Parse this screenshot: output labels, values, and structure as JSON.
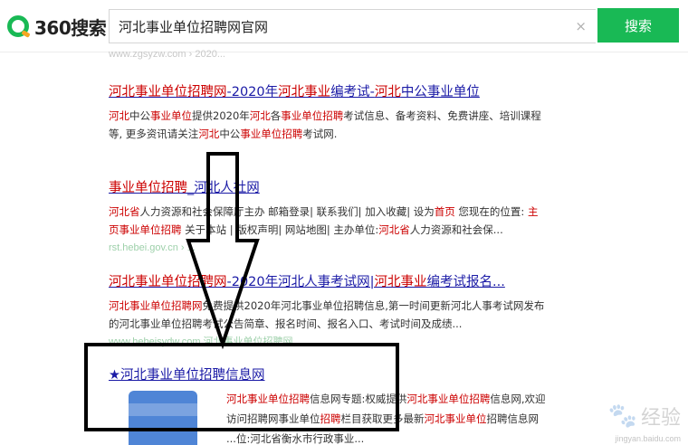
{
  "header": {
    "logo_text": "360搜索",
    "search_value": "河北事业单位招聘网官网",
    "clear_icon": "×",
    "search_button": "搜索"
  },
  "faded_top_url": "www.zgsyzw.com › 2020...",
  "results": [
    {
      "title_a": "河北事业单位招聘网",
      "title_b": "-2020年",
      "title_c": "河北事业",
      "title_d": "编考试-",
      "title_e": "河北",
      "title_f": "中公事业单位",
      "desc1_a": "河北",
      "desc1_b": "中公",
      "desc1_c": "事业单位",
      "desc1_d": "提供2020年",
      "desc1_e": "河北",
      "desc1_f": "各",
      "desc1_g": "事业单位招聘",
      "desc1_h": "考试信息、备考资料、免费讲座、培训课程",
      "desc2_a": "等, 更多资讯请关注",
      "desc2_b": "河北",
      "desc2_c": "中公",
      "desc2_d": "事业单位招聘",
      "desc2_e": "考试网."
    },
    {
      "title_a": "事业单位招聘",
      "title_b": "_河北人社网",
      "desc1_a": "河北",
      "desc1_b": "省",
      "desc1_c": "人力资源和社会保障厅主办  邮箱登录| 联系我们| 加入收藏| 设为",
      "desc1_d": "首页",
      "desc1_e": "  您现在的位置: ",
      "desc1_f": "主",
      "desc2_a": "页",
      "desc2_b": "事业单位招聘",
      "desc2_c": " 关于本站 | 版权声明| 网站地图| 主办单位:",
      "desc2_d": "河北省",
      "desc2_e": "人力资源和社会保...",
      "url": "rst.hebei.gov.cn › ..."
    },
    {
      "title_a": "河北事业单位招聘网",
      "title_b": "-2020年河北人事考试网|",
      "title_c": "河北事业",
      "title_d": "编考试报名...",
      "desc1_a": "河北事业单位招聘网",
      "desc1_b": "免费提供2020年河北事业单位招聘信息,第一时间更新河北人事考试网发布",
      "desc2": "的河北事业单位招聘考试公告简章、报名时间、报名入口、考试时间及成绩...",
      "url": "www.hebeisydw.com  河北事业单位招聘网"
    },
    {
      "star": "★",
      "title": "河北事业单位招聘信息网",
      "line1_a": "河北事业单位招聘",
      "line1_b": "信息网专题:权威提供",
      "line1_c": "河北事业单位招聘",
      "line1_d": "信息网,欢迎",
      "line2_a": "访问招聘网事业单位",
      "line2_b": "招聘",
      "line2_c": "栏目获取更多最新",
      "line2_d": "河北事业单位",
      "line2_e": "招聘信息网",
      "line3": "...位:河北省衡水市行政事业..."
    }
  ],
  "watermark": {
    "text": "经验",
    "sub": "jingyan.baidu.com"
  }
}
